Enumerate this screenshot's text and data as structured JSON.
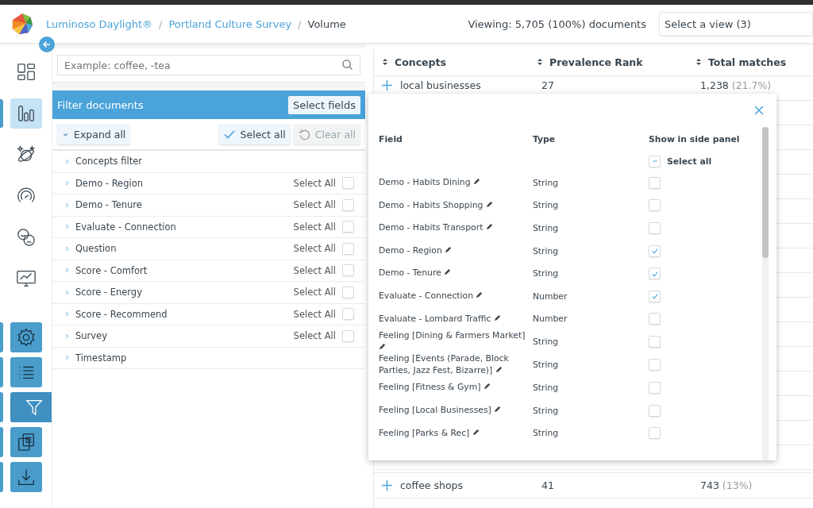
{
  "breadcrumb": [
    {
      "label": "Luminoso Daylight®",
      "link": true
    },
    {
      "separator": "/",
      "label": "Portland Culture Survey",
      "link": true
    },
    {
      "separator": "/",
      "label": "Volume",
      "link": false
    }
  ],
  "viewing": "Viewing: 5,705 (100%) documents",
  "view_select": {
    "placeholder": "Select a view (3)"
  },
  "rail": [
    {
      "kind": "plain",
      "selected": false
    },
    {
      "kind": "plain",
      "selected": true
    },
    {
      "kind": "plain",
      "selected": false
    },
    {
      "kind": "plain",
      "selected": false
    },
    {
      "kind": "plain",
      "selected": false
    },
    {
      "kind": "plain",
      "selected": false
    },
    {
      "kind": "tool",
      "selected": false
    },
    {
      "kind": "tool",
      "selected": false
    },
    {
      "kind": "tool",
      "selected": true
    },
    {
      "kind": "tool",
      "selected": false
    },
    {
      "kind": "tool",
      "selected": false
    }
  ],
  "search": {
    "placeholder": "Example: coffee, -tea"
  },
  "filter_panel": {
    "title": "Filter documents",
    "select_fields": "Select fields",
    "expand_all": "Expand all",
    "select_all": "Select all",
    "clear_all": "Clear all",
    "clear_disabled": true,
    "groups": [
      {
        "label": "Concepts filter"
      },
      {
        "label": "Demo - Region",
        "select_label": "Select All",
        "checked": false
      },
      {
        "label": "Demo - Tenure",
        "select_label": "Select All",
        "checked": false
      },
      {
        "label": "Evaluate - Connection",
        "select_label": "Select All",
        "checked": false
      },
      {
        "label": "Question",
        "select_label": "Select All",
        "checked": false
      },
      {
        "label": "Score - Comfort",
        "select_label": "Select All",
        "checked": false
      },
      {
        "label": "Score - Energy",
        "select_label": "Select All",
        "checked": false
      },
      {
        "label": "Score - Recommend",
        "select_label": "Select All",
        "checked": false
      },
      {
        "label": "Survey",
        "select_label": "Select All",
        "checked": false
      },
      {
        "label": "Timestamp"
      }
    ]
  },
  "table": {
    "columns": [
      "Concepts",
      "Prevalence Rank",
      "Total matches"
    ],
    "rows": [
      {
        "concept": "local businesses",
        "rank": "27",
        "matches": "1,238",
        "share": "(21.7%)"
      },
      {
        "concept": "coffee shops",
        "rank": "41",
        "matches": "743",
        "share": "(13%)"
      }
    ]
  },
  "fields_popup": {
    "columns": [
      "Field",
      "Type",
      "Show in side panel"
    ],
    "select_all": "Select all",
    "select_all_indeterminate": true,
    "rows": [
      {
        "field": "Demo - Habits Dining",
        "type": "String",
        "checked": false
      },
      {
        "field": "Demo - Habits Shopping",
        "type": "String",
        "checked": false
      },
      {
        "field": "Demo - Habits Transport",
        "type": "String",
        "checked": false
      },
      {
        "field": "Demo - Region",
        "type": "String",
        "checked": true
      },
      {
        "field": "Demo - Tenure",
        "type": "String",
        "checked": true
      },
      {
        "field": "Evaluate - Connection",
        "type": "Number",
        "checked": true
      },
      {
        "field": "Evaluate - Lombard Traffic",
        "type": "Number",
        "checked": false
      },
      {
        "field": "Feeling [Dining & Farmers Market]",
        "type": "String",
        "checked": false
      },
      {
        "field": "Feeling [Events (Parade, Block Parties, Jazz Fest, Bizarre)]",
        "type": "String",
        "checked": false
      },
      {
        "field": "Feeling [Fitness & Gym]",
        "type": "String",
        "checked": false
      },
      {
        "field": "Feeling [Local Businesses]",
        "type": "String",
        "checked": false
      },
      {
        "field": "Feeling [Parks & Rec]",
        "type": "String",
        "checked": false
      }
    ]
  }
}
